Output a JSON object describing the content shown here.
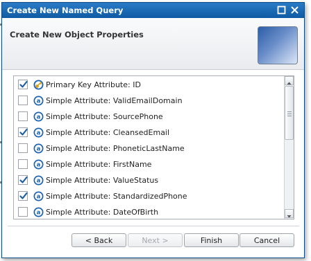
{
  "window": {
    "title": "Create New Named Query",
    "controls": [
      "maximize-icon",
      "close-icon"
    ]
  },
  "header": {
    "heading": "Create New Object Properties",
    "image": "wizard-banner-image"
  },
  "attributes": [
    {
      "label": "Primary Key Attribute: ID",
      "checked": true,
      "icon": "key-attribute-icon"
    },
    {
      "label": "Simple Attribute: ValidEmailDomain",
      "checked": false,
      "icon": "attribute-icon"
    },
    {
      "label": "Simple Attribute: SourcePhone",
      "checked": false,
      "icon": "attribute-icon"
    },
    {
      "label": "Simple Attribute: CleansedEmail",
      "checked": true,
      "icon": "attribute-icon"
    },
    {
      "label": "Simple Attribute: PhoneticLastName",
      "checked": false,
      "icon": "attribute-icon"
    },
    {
      "label": "Simple Attribute: FirstName",
      "checked": false,
      "icon": "attribute-icon"
    },
    {
      "label": "Simple Attribute: ValueStatus",
      "checked": true,
      "icon": "attribute-icon"
    },
    {
      "label": "Simple Attribute: StandardizedPhone",
      "checked": true,
      "icon": "attribute-icon"
    },
    {
      "label": "Simple Attribute: DateOfBirth",
      "checked": false,
      "icon": "attribute-icon"
    }
  ],
  "buttons": {
    "back": "< Back",
    "next": "Next >",
    "finish": "Finish",
    "cancel": "Cancel"
  },
  "colors": {
    "titlebar": "#1467b3",
    "checkmark": "#1b5fa8",
    "attribute_icon": "#1e63b0",
    "key_icon": "#d9a21e"
  }
}
